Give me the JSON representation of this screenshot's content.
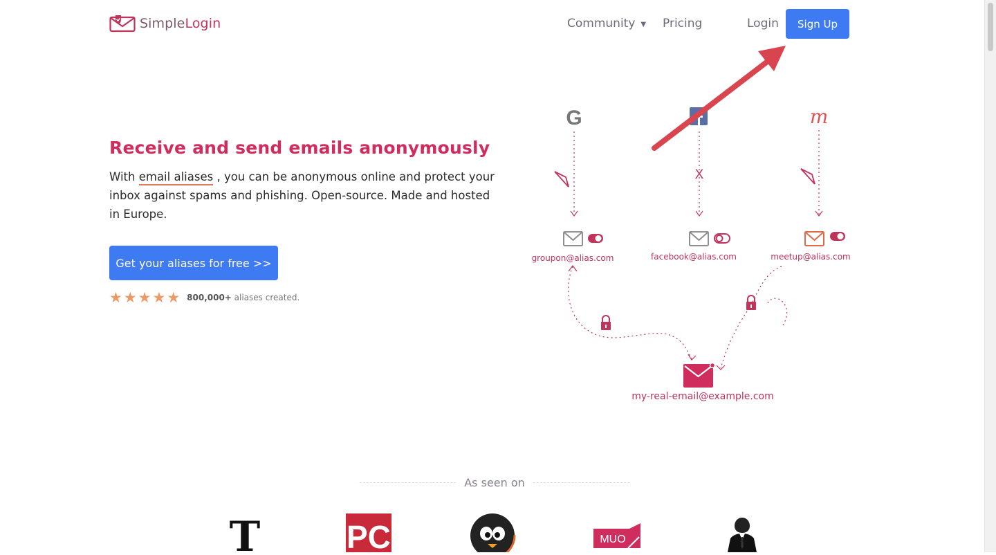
{
  "header": {
    "logo": {
      "text_part1": "Simple",
      "text_part2": "Login"
    },
    "nav": {
      "community": "Community",
      "pricing": "Pricing",
      "login": "Login",
      "signup": "Sign Up"
    }
  },
  "hero": {
    "headline": "Receive and send emails anonymously",
    "desc_prefix": "With ",
    "desc_link": "email aliases",
    "desc_suffix": " , you can be anonymous online and protect your inbox against spams and phishing. Open-source. Made and hosted in Europe.",
    "cta": "Get your aliases for free >>",
    "rating_count": "800,000+",
    "rating_suffix": " aliases created."
  },
  "illustration": {
    "x_mark": "X",
    "aliases": [
      "groupon@alias.com",
      "facebook@alias.com",
      "meetup@alias.com"
    ],
    "real_email": "my-real-email@example.com"
  },
  "press": {
    "label": "As seen on",
    "icons": [
      "nytimes-logo",
      "pcmag-logo",
      "linux-logo",
      "muo-logo",
      "suit-figure-logo"
    ]
  },
  "colors": {
    "accent": "#d02d5f",
    "primary_button": "#3e7bf2",
    "star": "#eb9a66"
  }
}
